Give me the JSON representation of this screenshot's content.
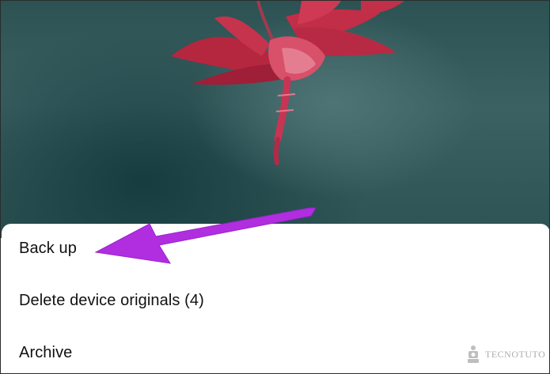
{
  "photo": {
    "subject": "pink-flower",
    "background_color": "#2f5557",
    "flower_color": "#c0314f"
  },
  "menu": {
    "items": [
      {
        "label": "Back up"
      },
      {
        "label": "Delete device originals (4)"
      },
      {
        "label": "Archive"
      }
    ]
  },
  "annotation": {
    "arrow_color": "#b02ee0"
  },
  "watermark": {
    "text": "TECNOTUTO"
  }
}
